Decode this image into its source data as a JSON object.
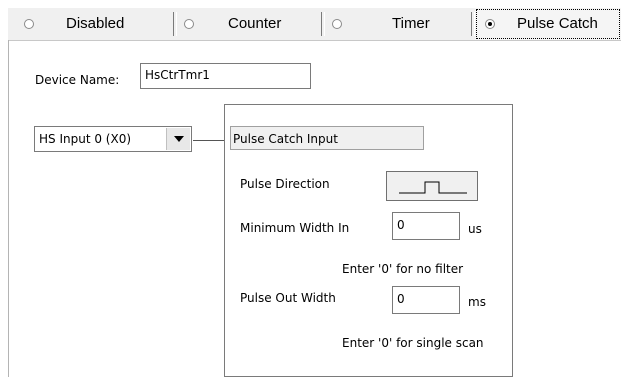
{
  "tabs": [
    {
      "label": "Disabled",
      "selected": false
    },
    {
      "label": "Counter",
      "selected": false
    },
    {
      "label": "Timer",
      "selected": false
    },
    {
      "label": "Pulse Catch",
      "selected": true
    }
  ],
  "device": {
    "label": "Device Name:",
    "value": "HsCtrTmr1"
  },
  "input_select": {
    "value": "HS Input 0 (X0)"
  },
  "pulse_catch": {
    "title": "Pulse Catch Input",
    "pulse_direction_label": "Pulse Direction",
    "min_width_label": "Minimum Width In",
    "min_width_value": "0",
    "min_width_unit": "us",
    "min_width_hint": "Enter '0' for no filter",
    "pulse_out_label": "Pulse Out Width",
    "pulse_out_value": "0",
    "pulse_out_unit": "ms",
    "pulse_out_hint": "Enter '0' for single scan"
  }
}
